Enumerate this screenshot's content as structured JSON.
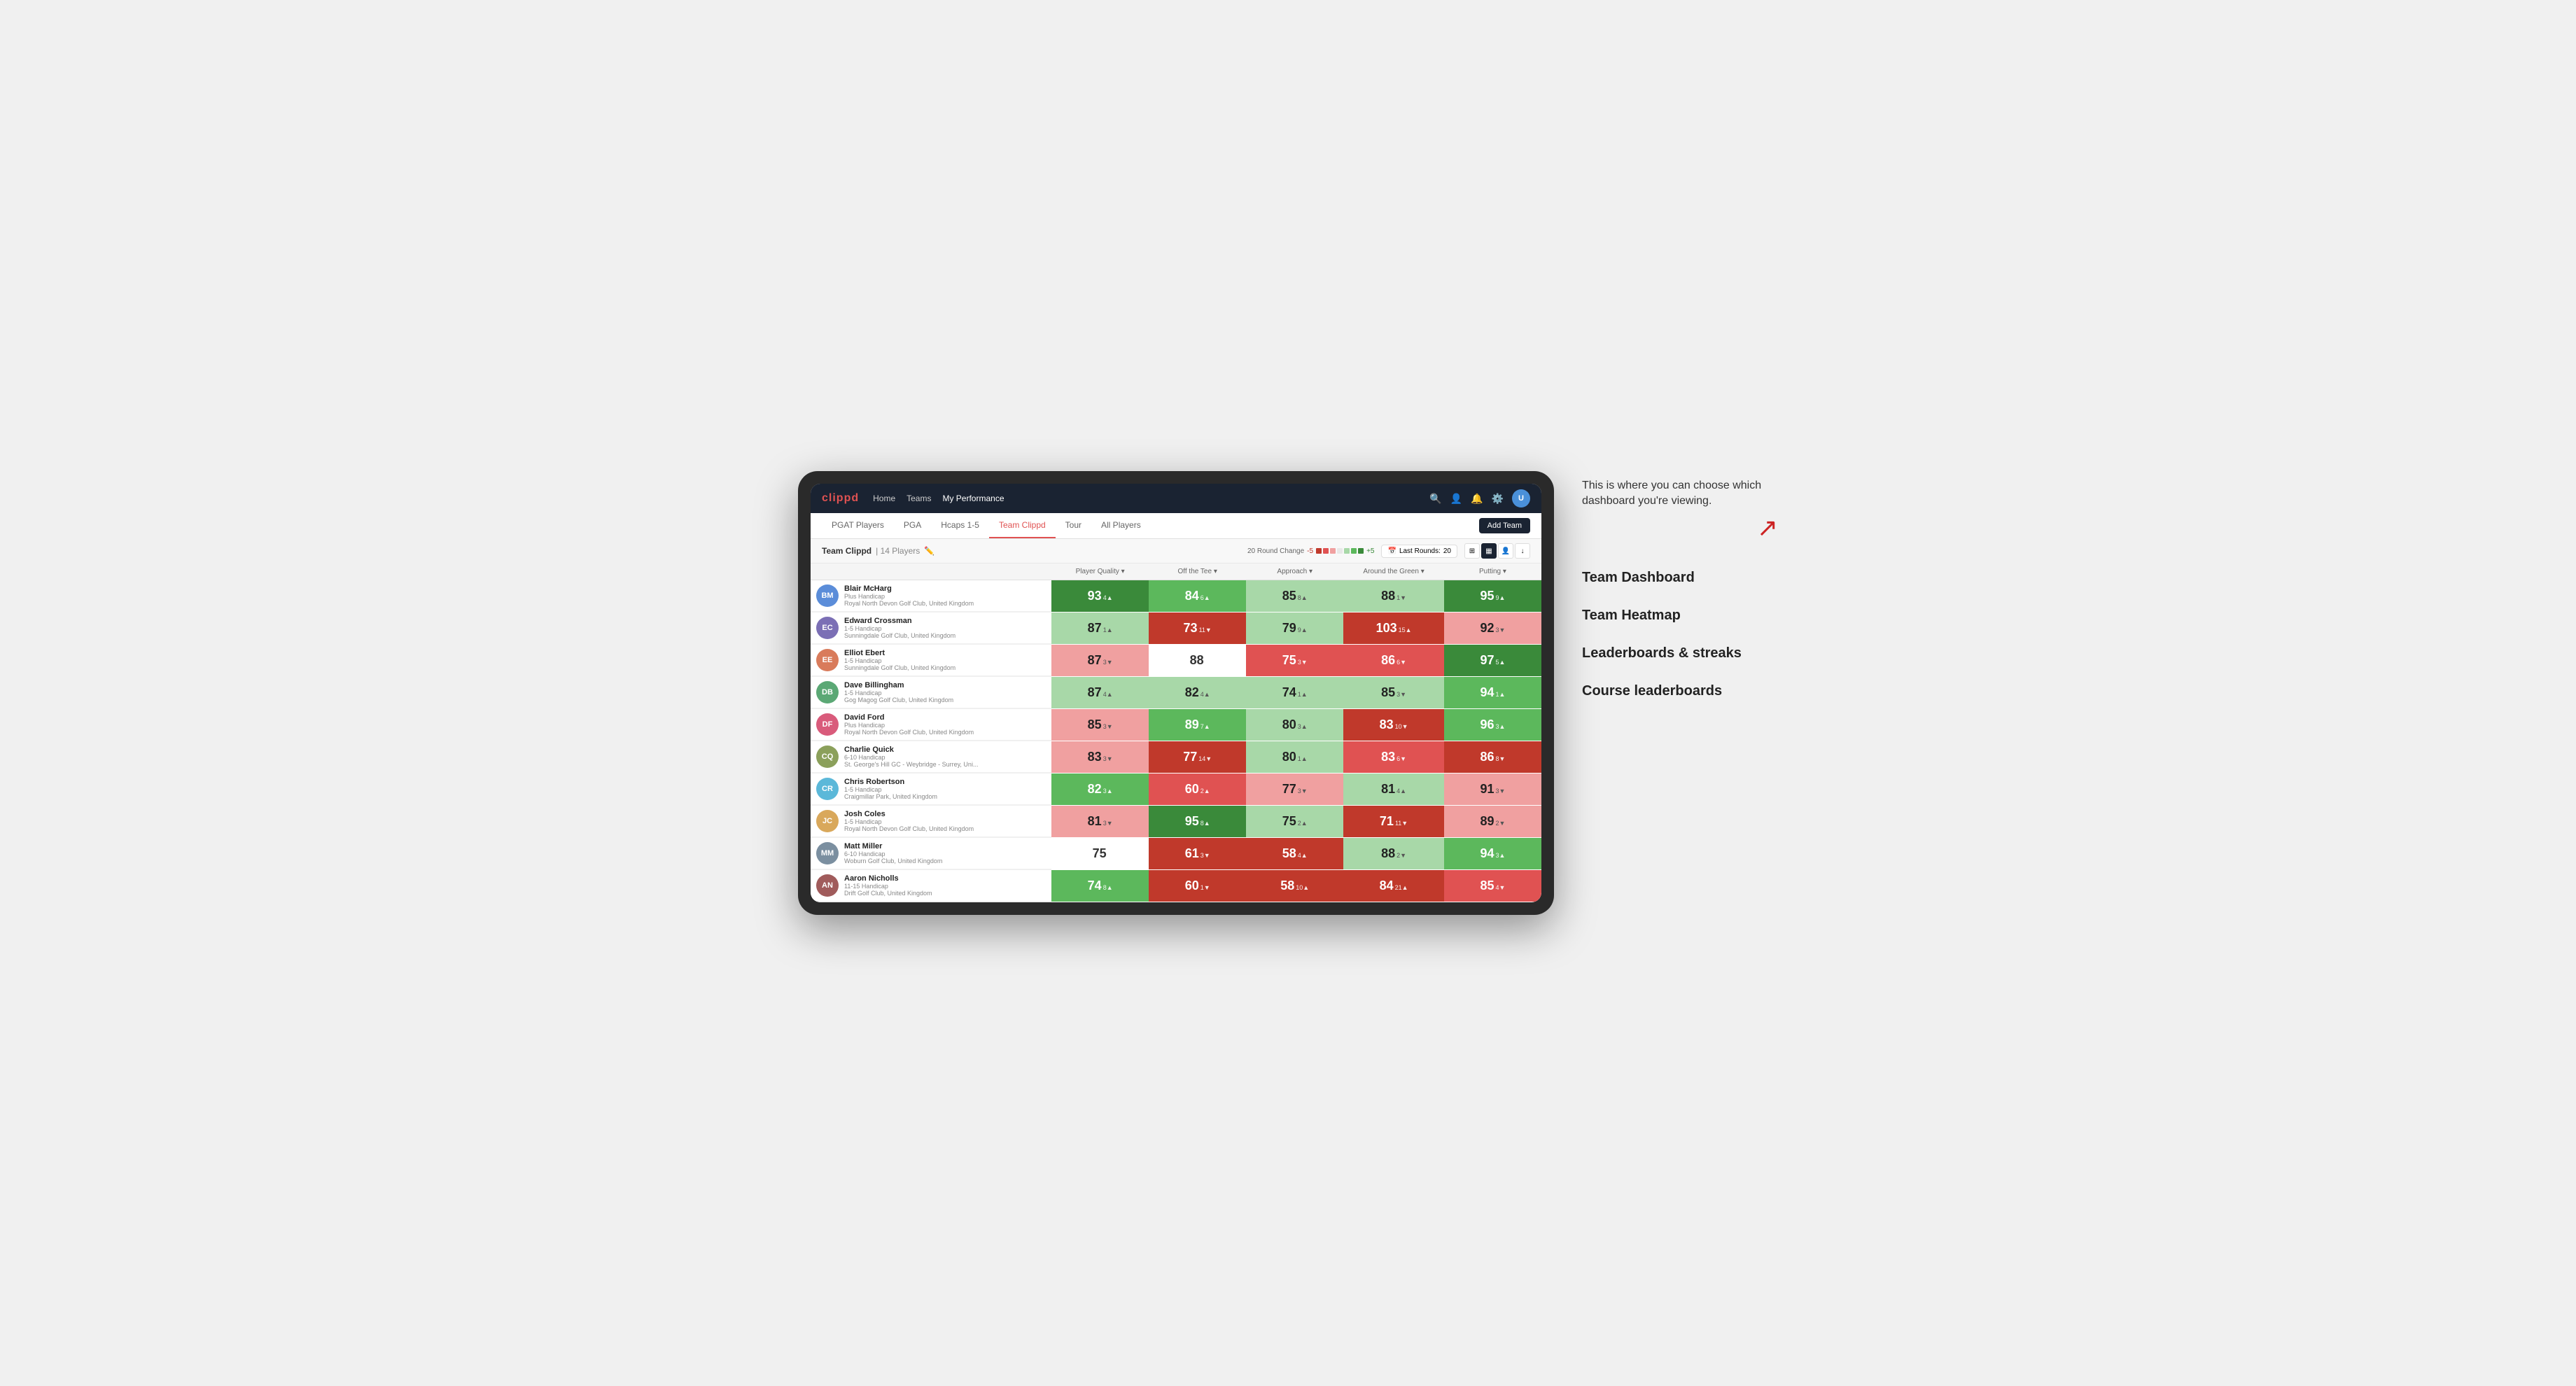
{
  "annotation": {
    "intro_text": "This is where you can choose which dashboard you're viewing.",
    "options": [
      "Team Dashboard",
      "Team Heatmap",
      "Leaderboards & streaks",
      "Course leaderboards"
    ]
  },
  "nav": {
    "logo": "clippd",
    "links": [
      "Home",
      "Teams",
      "My Performance"
    ],
    "active_link": "My Performance"
  },
  "sub_nav": {
    "tabs": [
      "PGAT Players",
      "PGA",
      "Hcaps 1-5",
      "Team Clippd",
      "Tour",
      "All Players"
    ],
    "active_tab": "Team Clippd",
    "add_team_label": "Add Team"
  },
  "team_bar": {
    "name": "Team Clippd",
    "player_count": "14 Players",
    "round_change_label": "20 Round Change",
    "change_low": "-5",
    "change_high": "+5",
    "last_rounds_label": "Last Rounds:",
    "last_rounds_value": "20"
  },
  "table": {
    "columns": [
      "Player Quality ▾",
      "Off the Tee ▾",
      "Approach ▾",
      "Around the Green ▾",
      "Putting ▾"
    ],
    "players": [
      {
        "name": "Blair McHarg",
        "handicap": "Plus Handicap",
        "club": "Royal North Devon Golf Club, United Kingdom",
        "initials": "BM",
        "scores": [
          {
            "value": "93",
            "change": "4▲",
            "bg": "bg-green-dark"
          },
          {
            "value": "84",
            "change": "6▲",
            "bg": "bg-green-mid"
          },
          {
            "value": "85",
            "change": "8▲",
            "bg": "bg-green-light"
          },
          {
            "value": "88",
            "change": "1▼",
            "bg": "bg-green-light"
          },
          {
            "value": "95",
            "change": "9▲",
            "bg": "bg-green-dark"
          }
        ]
      },
      {
        "name": "Edward Crossman",
        "handicap": "1-5 Handicap",
        "club": "Sunningdale Golf Club, United Kingdom",
        "initials": "EC",
        "scores": [
          {
            "value": "87",
            "change": "1▲",
            "bg": "bg-green-light"
          },
          {
            "value": "73",
            "change": "11▼",
            "bg": "bg-red-dark"
          },
          {
            "value": "79",
            "change": "9▲",
            "bg": "bg-green-light"
          },
          {
            "value": "103",
            "change": "15▲",
            "bg": "bg-red-dark"
          },
          {
            "value": "92",
            "change": "3▼",
            "bg": "bg-red-light"
          }
        ]
      },
      {
        "name": "Elliot Ebert",
        "handicap": "1-5 Handicap",
        "club": "Sunningdale Golf Club, United Kingdom",
        "initials": "EE",
        "scores": [
          {
            "value": "87",
            "change": "3▼",
            "bg": "bg-red-light"
          },
          {
            "value": "88",
            "change": "",
            "bg": "bg-white"
          },
          {
            "value": "75",
            "change": "3▼",
            "bg": "bg-red-mid"
          },
          {
            "value": "86",
            "change": "6▼",
            "bg": "bg-red-mid"
          },
          {
            "value": "97",
            "change": "5▲",
            "bg": "bg-green-dark"
          }
        ]
      },
      {
        "name": "Dave Billingham",
        "handicap": "1-5 Handicap",
        "club": "Gog Magog Golf Club, United Kingdom",
        "initials": "DB",
        "scores": [
          {
            "value": "87",
            "change": "4▲",
            "bg": "bg-green-light"
          },
          {
            "value": "82",
            "change": "4▲",
            "bg": "bg-green-light"
          },
          {
            "value": "74",
            "change": "1▲",
            "bg": "bg-green-light"
          },
          {
            "value": "85",
            "change": "3▼",
            "bg": "bg-green-light"
          },
          {
            "value": "94",
            "change": "1▲",
            "bg": "bg-green-mid"
          }
        ]
      },
      {
        "name": "David Ford",
        "handicap": "Plus Handicap",
        "club": "Royal North Devon Golf Club, United Kingdom",
        "initials": "DF",
        "scores": [
          {
            "value": "85",
            "change": "3▼",
            "bg": "bg-red-light"
          },
          {
            "value": "89",
            "change": "7▲",
            "bg": "bg-green-mid"
          },
          {
            "value": "80",
            "change": "3▲",
            "bg": "bg-green-light"
          },
          {
            "value": "83",
            "change": "10▼",
            "bg": "bg-red-dark"
          },
          {
            "value": "96",
            "change": "3▲",
            "bg": "bg-green-mid"
          }
        ]
      },
      {
        "name": "Charlie Quick",
        "handicap": "6-10 Handicap",
        "club": "St. George's Hill GC - Weybridge - Surrey, Uni...",
        "initials": "CQ",
        "scores": [
          {
            "value": "83",
            "change": "3▼",
            "bg": "bg-red-light"
          },
          {
            "value": "77",
            "change": "14▼",
            "bg": "bg-red-dark"
          },
          {
            "value": "80",
            "change": "1▲",
            "bg": "bg-green-light"
          },
          {
            "value": "83",
            "change": "6▼",
            "bg": "bg-red-mid"
          },
          {
            "value": "86",
            "change": "8▼",
            "bg": "bg-red-dark"
          }
        ]
      },
      {
        "name": "Chris Robertson",
        "handicap": "1-5 Handicap",
        "club": "Craigmillar Park, United Kingdom",
        "initials": "CR",
        "scores": [
          {
            "value": "82",
            "change": "3▲",
            "bg": "bg-green-mid"
          },
          {
            "value": "60",
            "change": "2▲",
            "bg": "bg-red-mid"
          },
          {
            "value": "77",
            "change": "3▼",
            "bg": "bg-red-light"
          },
          {
            "value": "81",
            "change": "4▲",
            "bg": "bg-green-light"
          },
          {
            "value": "91",
            "change": "3▼",
            "bg": "bg-red-light"
          }
        ]
      },
      {
        "name": "Josh Coles",
        "handicap": "1-5 Handicap",
        "club": "Royal North Devon Golf Club, United Kingdom",
        "initials": "JC",
        "scores": [
          {
            "value": "81",
            "change": "3▼",
            "bg": "bg-red-light"
          },
          {
            "value": "95",
            "change": "8▲",
            "bg": "bg-green-dark"
          },
          {
            "value": "75",
            "change": "2▲",
            "bg": "bg-green-light"
          },
          {
            "value": "71",
            "change": "11▼",
            "bg": "bg-red-dark"
          },
          {
            "value": "89",
            "change": "2▼",
            "bg": "bg-red-light"
          }
        ]
      },
      {
        "name": "Matt Miller",
        "handicap": "6-10 Handicap",
        "club": "Woburn Golf Club, United Kingdom",
        "initials": "MM",
        "scores": [
          {
            "value": "75",
            "change": "",
            "bg": "bg-white"
          },
          {
            "value": "61",
            "change": "3▼",
            "bg": "bg-red-dark"
          },
          {
            "value": "58",
            "change": "4▲",
            "bg": "bg-red-dark"
          },
          {
            "value": "88",
            "change": "2▼",
            "bg": "bg-green-light"
          },
          {
            "value": "94",
            "change": "3▲",
            "bg": "bg-green-mid"
          }
        ]
      },
      {
        "name": "Aaron Nicholls",
        "handicap": "11-15 Handicap",
        "club": "Drift Golf Club, United Kingdom",
        "initials": "AN",
        "scores": [
          {
            "value": "74",
            "change": "8▲",
            "bg": "bg-green-mid"
          },
          {
            "value": "60",
            "change": "1▼",
            "bg": "bg-red-dark"
          },
          {
            "value": "58",
            "change": "10▲",
            "bg": "bg-red-dark"
          },
          {
            "value": "84",
            "change": "21▲",
            "bg": "bg-red-dark"
          },
          {
            "value": "85",
            "change": "4▼",
            "bg": "bg-red-mid"
          }
        ]
      }
    ]
  },
  "avatarColors": [
    "#5b8dd9",
    "#7b6fb5",
    "#d97b5b",
    "#5ba875",
    "#d95b7b",
    "#8ba05b",
    "#5bb8d9",
    "#d9a85b",
    "#7b8fa0",
    "#a05b5b"
  ]
}
